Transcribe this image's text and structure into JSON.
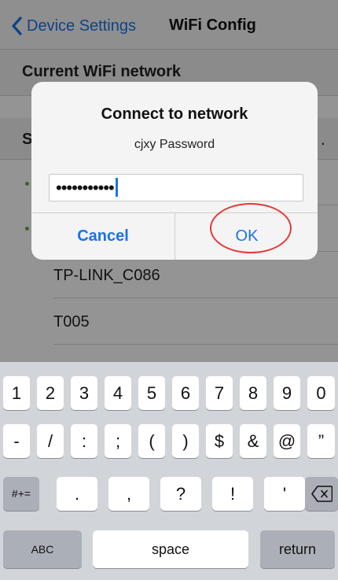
{
  "nav": {
    "back_label": "Device Settings",
    "title": "WiFi Config"
  },
  "sections": {
    "current_wifi": "Current WiFi network",
    "select_prefix": "S",
    "select_suffix": "."
  },
  "networks": [
    "TP-LINK_C086",
    "T005"
  ],
  "alert": {
    "title": "Connect to network",
    "message": "cjxy Password",
    "password_masked": "•••••••••••",
    "cancel_label": "Cancel",
    "ok_label": "OK"
  },
  "keyboard": {
    "row1": [
      "1",
      "2",
      "3",
      "4",
      "5",
      "6",
      "7",
      "8",
      "9",
      "0"
    ],
    "row2": [
      "-",
      "/",
      ":",
      ";",
      "(",
      ")",
      "$",
      "&",
      "@",
      "”"
    ],
    "row3_left": "#+=",
    "row3": [
      ".",
      ",",
      "?",
      "!",
      "'"
    ],
    "abc_label": "ABC",
    "space_label": "space",
    "return_label": "return"
  },
  "colors": {
    "accent": "#1a73e8",
    "annotation": "#e53935"
  },
  "icons": {
    "back": "chevron-left-icon",
    "delete": "backspace-icon"
  }
}
